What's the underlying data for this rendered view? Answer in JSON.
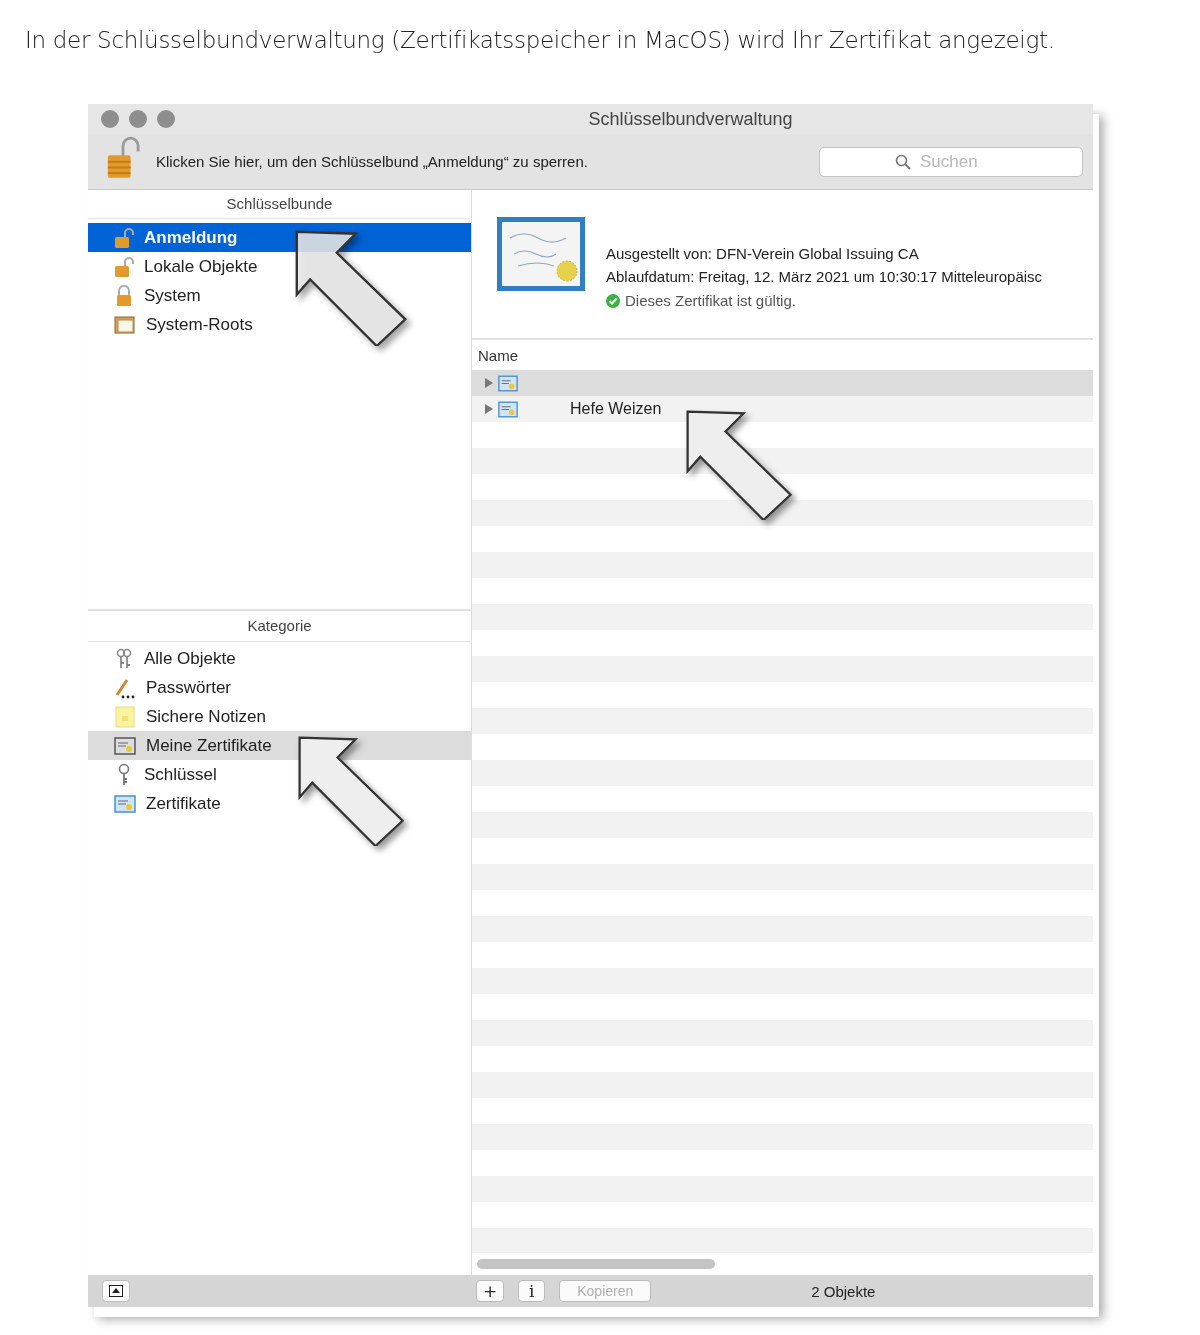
{
  "caption": "In der Schlüsselbundverwaltung (Zertifikatsspeicher in MacOS) wird Ihr Zertifikat angezeigt.",
  "window": {
    "title": "Schlüsselbundverwaltung"
  },
  "toolbar": {
    "lock_message": "Klicken Sie hier, um den Schlüsselbund „Anmeldung“ zu sperren.",
    "search": {
      "placeholder": "Suchen"
    }
  },
  "keychains": {
    "header": "Schlüsselbunde",
    "items": [
      {
        "label": "Anmeldung",
        "kind": "unlocked",
        "selected": true
      },
      {
        "label": "Lokale Objekte",
        "kind": "unlocked",
        "selected": false
      },
      {
        "label": "System",
        "kind": "locked",
        "selected": false
      },
      {
        "label": "System-Roots",
        "kind": "cabinet",
        "selected": false
      }
    ]
  },
  "categories": {
    "header": "Kategorie",
    "items": [
      {
        "label": "Alle Objekte",
        "kind": "all",
        "selected": false
      },
      {
        "label": "Passwörter",
        "kind": "password",
        "selected": false
      },
      {
        "label": "Sichere Notizen",
        "kind": "note",
        "selected": false
      },
      {
        "label": "Meine Zertifikate",
        "kind": "mycert",
        "selected": true
      },
      {
        "label": "Schlüssel",
        "kind": "key",
        "selected": false
      },
      {
        "label": "Zertifikate",
        "kind": "cert",
        "selected": false
      }
    ]
  },
  "certificate": {
    "issuer": "Ausgestellt von: DFN-Verein Global Issuing CA",
    "expiry": "Ablaufdatum: Freitag, 12. März 2021 um 10:30:17 Mitteleuropäisc",
    "status": "Dieses Zertifikat ist gültig.",
    "valid": true
  },
  "table": {
    "columns": [
      "Name"
    ],
    "rows": [
      {
        "name": "",
        "selected": true
      },
      {
        "name": "Hefe Weizen",
        "selected": false
      }
    ]
  },
  "bottom_bar": {
    "buttons": [
      {
        "label": "+",
        "disabled": false
      },
      {
        "label": "i",
        "disabled": false
      },
      {
        "label": "Kopieren",
        "disabled": true
      }
    ],
    "count": "2 Objekte"
  }
}
